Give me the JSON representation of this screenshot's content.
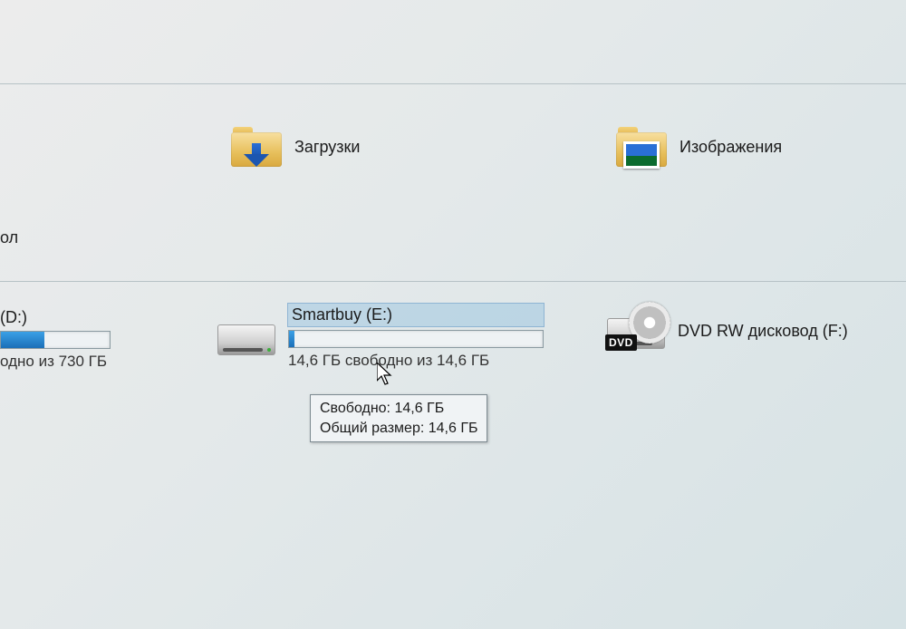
{
  "folders": {
    "downloads": {
      "label": "Загрузки"
    },
    "pictures": {
      "label": "Изображения"
    }
  },
  "partial": {
    "left_fragment_top": "ол",
    "drive_d_name": "(D:)",
    "drive_d_status": "одно из 730 ГБ"
  },
  "drives": {
    "e": {
      "name": "Smartbuy (E:)",
      "status": "14,6 ГБ свободно из 14,6 ГБ",
      "fill_percent": 2
    },
    "f": {
      "name": "DVD RW дисковод (F:)"
    }
  },
  "tooltip": {
    "line1": "Свободно: 14,6 ГБ",
    "line2": "Общий размер: 14,6 ГБ"
  },
  "badges": {
    "dvd": "DVD"
  }
}
